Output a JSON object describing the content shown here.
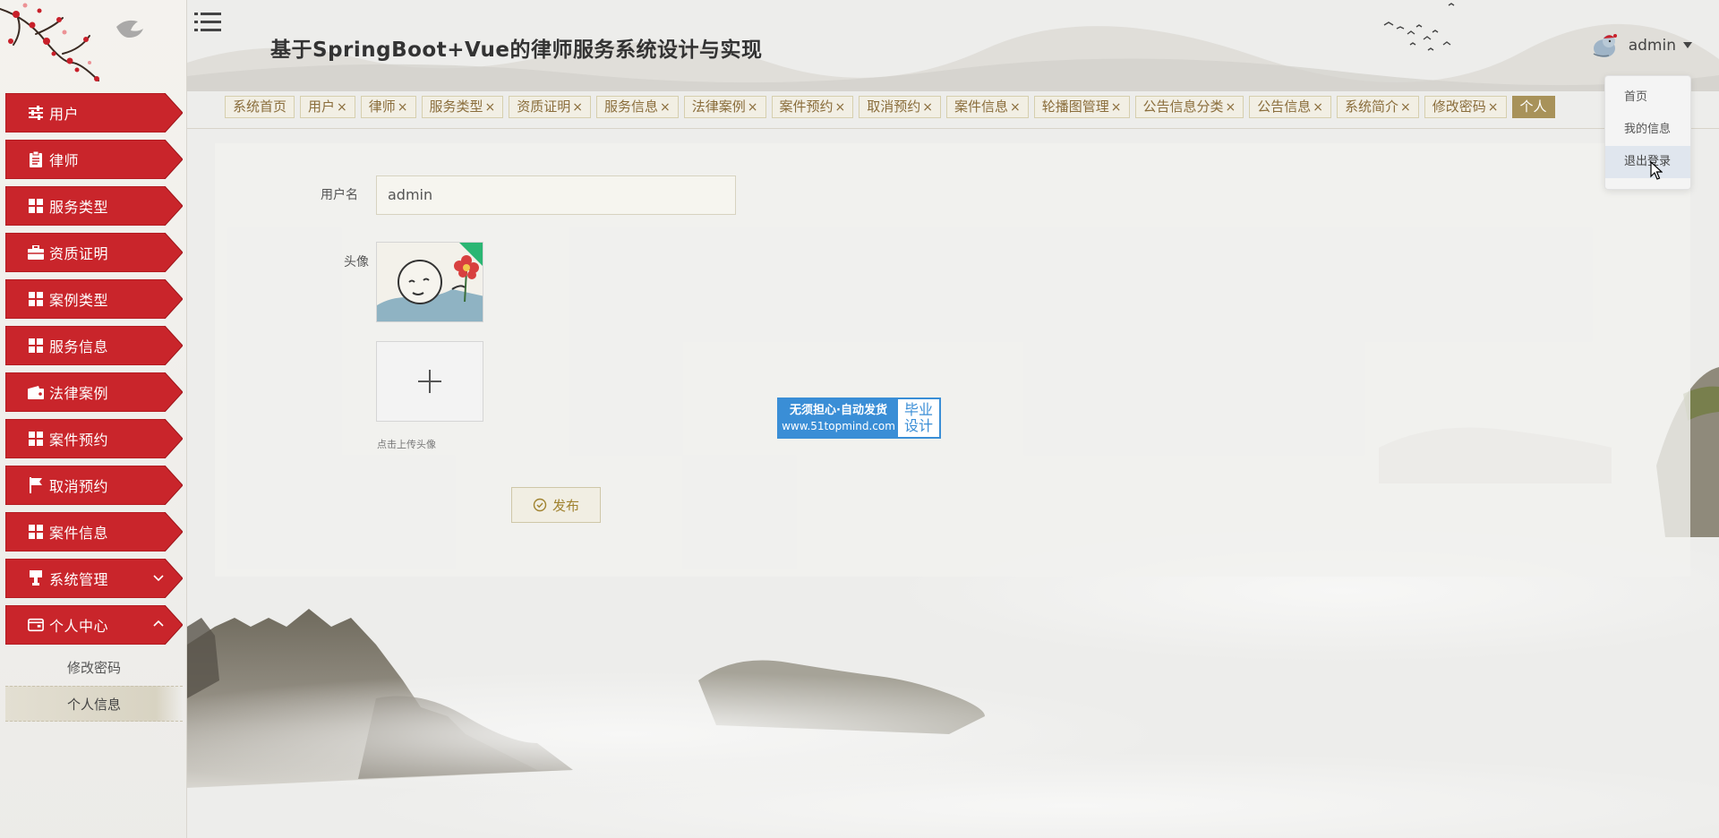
{
  "header": {
    "title": "基于SpringBoot+Vue的律师服务系统设计与实现",
    "username": "admin"
  },
  "sidebar": {
    "items": [
      {
        "label": "用户",
        "icon": "sliders-icon"
      },
      {
        "label": "律师",
        "icon": "clipboard-icon"
      },
      {
        "label": "服务类型",
        "icon": "grid-icon"
      },
      {
        "label": "资质证明",
        "icon": "briefcase-icon"
      },
      {
        "label": "案例类型",
        "icon": "grid-icon"
      },
      {
        "label": "服务信息",
        "icon": "grid-icon"
      },
      {
        "label": "法律案例",
        "icon": "wallet-icon"
      },
      {
        "label": "案件预约",
        "icon": "grid-icon"
      },
      {
        "label": "取消预约",
        "icon": "flag-icon"
      },
      {
        "label": "案件信息",
        "icon": "grid-icon"
      },
      {
        "label": "系统管理",
        "icon": "stamp-icon",
        "expandable": true,
        "expanded": false
      },
      {
        "label": "个人中心",
        "icon": "card-icon",
        "expandable": true,
        "expanded": true
      }
    ],
    "submenu": [
      {
        "label": "修改密码",
        "active": false
      },
      {
        "label": "个人信息",
        "active": true
      }
    ]
  },
  "tabs": [
    {
      "label": "系统首页",
      "closable": false
    },
    {
      "label": "用户",
      "closable": true
    },
    {
      "label": "律师",
      "closable": true
    },
    {
      "label": "服务类型",
      "closable": true
    },
    {
      "label": "资质证明",
      "closable": true
    },
    {
      "label": "服务信息",
      "closable": true
    },
    {
      "label": "法律案例",
      "closable": true
    },
    {
      "label": "案件预约",
      "closable": true
    },
    {
      "label": "取消预约",
      "closable": true
    },
    {
      "label": "案件信息",
      "closable": true
    },
    {
      "label": "轮播图管理",
      "closable": true
    },
    {
      "label": "公告信息分类",
      "closable": true
    },
    {
      "label": "公告信息",
      "closable": true
    },
    {
      "label": "系统简介",
      "closable": true
    },
    {
      "label": "修改密码",
      "closable": true
    },
    {
      "label": "个人",
      "closable": false,
      "active": true
    }
  ],
  "tab_close_glyph": "×",
  "form": {
    "username_label": "用户名",
    "username_value": "admin",
    "avatar_label": "头像",
    "upload_hint": "点击上传头像",
    "publish_label": "发布"
  },
  "dropdown": {
    "items": [
      "首页",
      "我的信息",
      "退出登录"
    ],
    "hovered_index": 2
  },
  "watermark": {
    "slogan": "无须担心·自动发货",
    "url": "www.51topmind.com",
    "badge_line1": "毕业",
    "badge_line2": "设计"
  },
  "colors": {
    "menu_red": "#c9252b",
    "menu_red_dark": "#9e1419",
    "tab_border": "#d6cfae",
    "tab_text": "#8a6d3b",
    "tab_active_bg": "#a8925a",
    "watermark_blue": "#3a8ed6"
  }
}
